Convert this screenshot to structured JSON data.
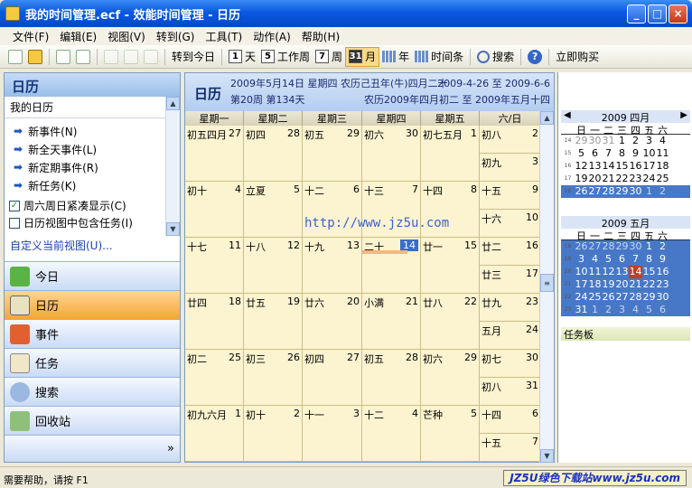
{
  "window": {
    "title": "我的时间管理.ecf - 效能时间管理 - 日历",
    "min": "_",
    "max": "□",
    "close": "×"
  },
  "menu": [
    "文件(F)",
    "编辑(E)",
    "视图(V)",
    "转到(G)",
    "工具(T)",
    "动作(A)",
    "帮助(H)"
  ],
  "toolbar": {
    "today": "转到今日",
    "day_num": "1",
    "day": "天",
    "workweek_num": "5",
    "workweek": "工作周",
    "week_num": "7",
    "week": "周",
    "month_num": "31",
    "month": "月",
    "year": "年",
    "timeline": "时间条",
    "search": "搜索",
    "help": "?",
    "buy": "立即购买"
  },
  "left": {
    "title": "日历",
    "subtitle": "我的日历",
    "tasks": [
      "新事件(N)",
      "新全天事件(L)",
      "新定期事件(R)",
      "新任务(K)"
    ],
    "check1": "周六周日紧凑显示(C)",
    "check2": "日历视图中包含任务(I)",
    "custom": "自定义当前视图(U)...",
    "nav": [
      "今日",
      "日历",
      "事件",
      "任务",
      "搜索",
      "回收站"
    ]
  },
  "calendar": {
    "title": "日历",
    "date_line": "2009年5月14日 星期四 农历己丑年(牛)四月二十",
    "week_line": "第20周 第134天",
    "range1": "2009-4-26 至 2009-6-6",
    "range2": "农历2009年四月初二 至 2009年五月十四",
    "days": [
      "星期一",
      "星期二",
      "星期三",
      "星期四",
      "星期五",
      "六/日"
    ],
    "rows": [
      [
        [
          "初五四月",
          "27"
        ],
        [
          "初四",
          "28"
        ],
        [
          "初五",
          "29"
        ],
        [
          "初六",
          "30"
        ],
        [
          "初七五月",
          "1"
        ],
        [
          "初八",
          "2"
        ],
        [
          "初九",
          "3"
        ]
      ],
      [
        [
          "初十",
          "4"
        ],
        [
          "立夏",
          "5"
        ],
        [
          "十二",
          "6"
        ],
        [
          "十三",
          "7"
        ],
        [
          "十四",
          "8"
        ],
        [
          "十五",
          "9"
        ],
        [
          "十六",
          "10"
        ]
      ],
      [
        [
          "十七",
          "11"
        ],
        [
          "十八",
          "12"
        ],
        [
          "十九",
          "13"
        ],
        [
          "二十",
          "14"
        ],
        [
          "廿一",
          "15"
        ],
        [
          "廿二",
          "16"
        ],
        [
          "廿三",
          "17"
        ]
      ],
      [
        [
          "廿四",
          "18"
        ],
        [
          "廿五",
          "19"
        ],
        [
          "廿六",
          "20"
        ],
        [
          "小满",
          "21"
        ],
        [
          "廿八",
          "22"
        ],
        [
          "廿九",
          "23"
        ],
        [
          "五月",
          "24"
        ]
      ],
      [
        [
          "初二",
          "25"
        ],
        [
          "初三",
          "26"
        ],
        [
          "初四",
          "27"
        ],
        [
          "初五",
          "28"
        ],
        [
          "初六",
          "29"
        ],
        [
          "初七",
          "30"
        ],
        [
          "初八",
          "31"
        ]
      ],
      [
        [
          "初九六月",
          "1"
        ],
        [
          "初十",
          "2"
        ],
        [
          "十一",
          "3"
        ],
        [
          "十二",
          "4"
        ],
        [
          "芒种",
          "5"
        ],
        [
          "十四",
          "6"
        ],
        [
          "十五",
          "7"
        ]
      ]
    ],
    "watermark": "http://www.jz5u.com"
  },
  "mini1": {
    "title": "2009 四月",
    "prev": "◀",
    "next": "▶",
    "dow": [
      "日",
      "一",
      "二",
      "三",
      "四",
      "五",
      "六"
    ],
    "rows": [
      [
        "14",
        [
          "29",
          "o"
        ],
        [
          "30",
          "o"
        ],
        [
          "31",
          "o"
        ],
        "1",
        "2",
        "3",
        "4"
      ],
      [
        "15",
        "5",
        "6",
        "7",
        "8",
        "9",
        "10",
        "11"
      ],
      [
        "16",
        "12",
        "13",
        "14",
        "15",
        "16",
        "17",
        "18"
      ],
      [
        "17",
        "19",
        "20",
        "21",
        "22",
        "23",
        "24",
        "25"
      ],
      [
        "18",
        "26",
        "27",
        "28",
        "29",
        "30",
        [
          "1",
          "o"
        ],
        [
          "2",
          "o"
        ]
      ]
    ]
  },
  "mini2": {
    "title": "2009 五月",
    "dow": [
      "日",
      "一",
      "二",
      "三",
      "四",
      "五",
      "六"
    ],
    "rows": [
      [
        "18",
        [
          "26",
          "o"
        ],
        [
          "27",
          "o"
        ],
        [
          "28",
          "o"
        ],
        [
          "29",
          "o"
        ],
        [
          "30",
          "o"
        ],
        "1",
        "2"
      ],
      [
        "19",
        "3",
        "4",
        "5",
        "6",
        "7",
        "8",
        "9"
      ],
      [
        "20",
        "10",
        "11",
        "12",
        "13",
        "14",
        "15",
        "16"
      ],
      [
        "21",
        "17",
        "18",
        "19",
        "20",
        "21",
        "22",
        "23"
      ],
      [
        "22",
        "24",
        "25",
        "26",
        "27",
        "28",
        "29",
        "30"
      ],
      [
        "23",
        "31",
        [
          "1",
          "o"
        ],
        [
          "2",
          "o"
        ],
        [
          "3",
          "o"
        ],
        [
          "4",
          "o"
        ],
        [
          "5",
          "o"
        ],
        [
          "6",
          "o"
        ]
      ]
    ]
  },
  "taskpad": "任务板",
  "status": {
    "left": "需要帮助，请按 F1",
    "right": "JZ5U绿色下载站www.jz5u.com"
  }
}
